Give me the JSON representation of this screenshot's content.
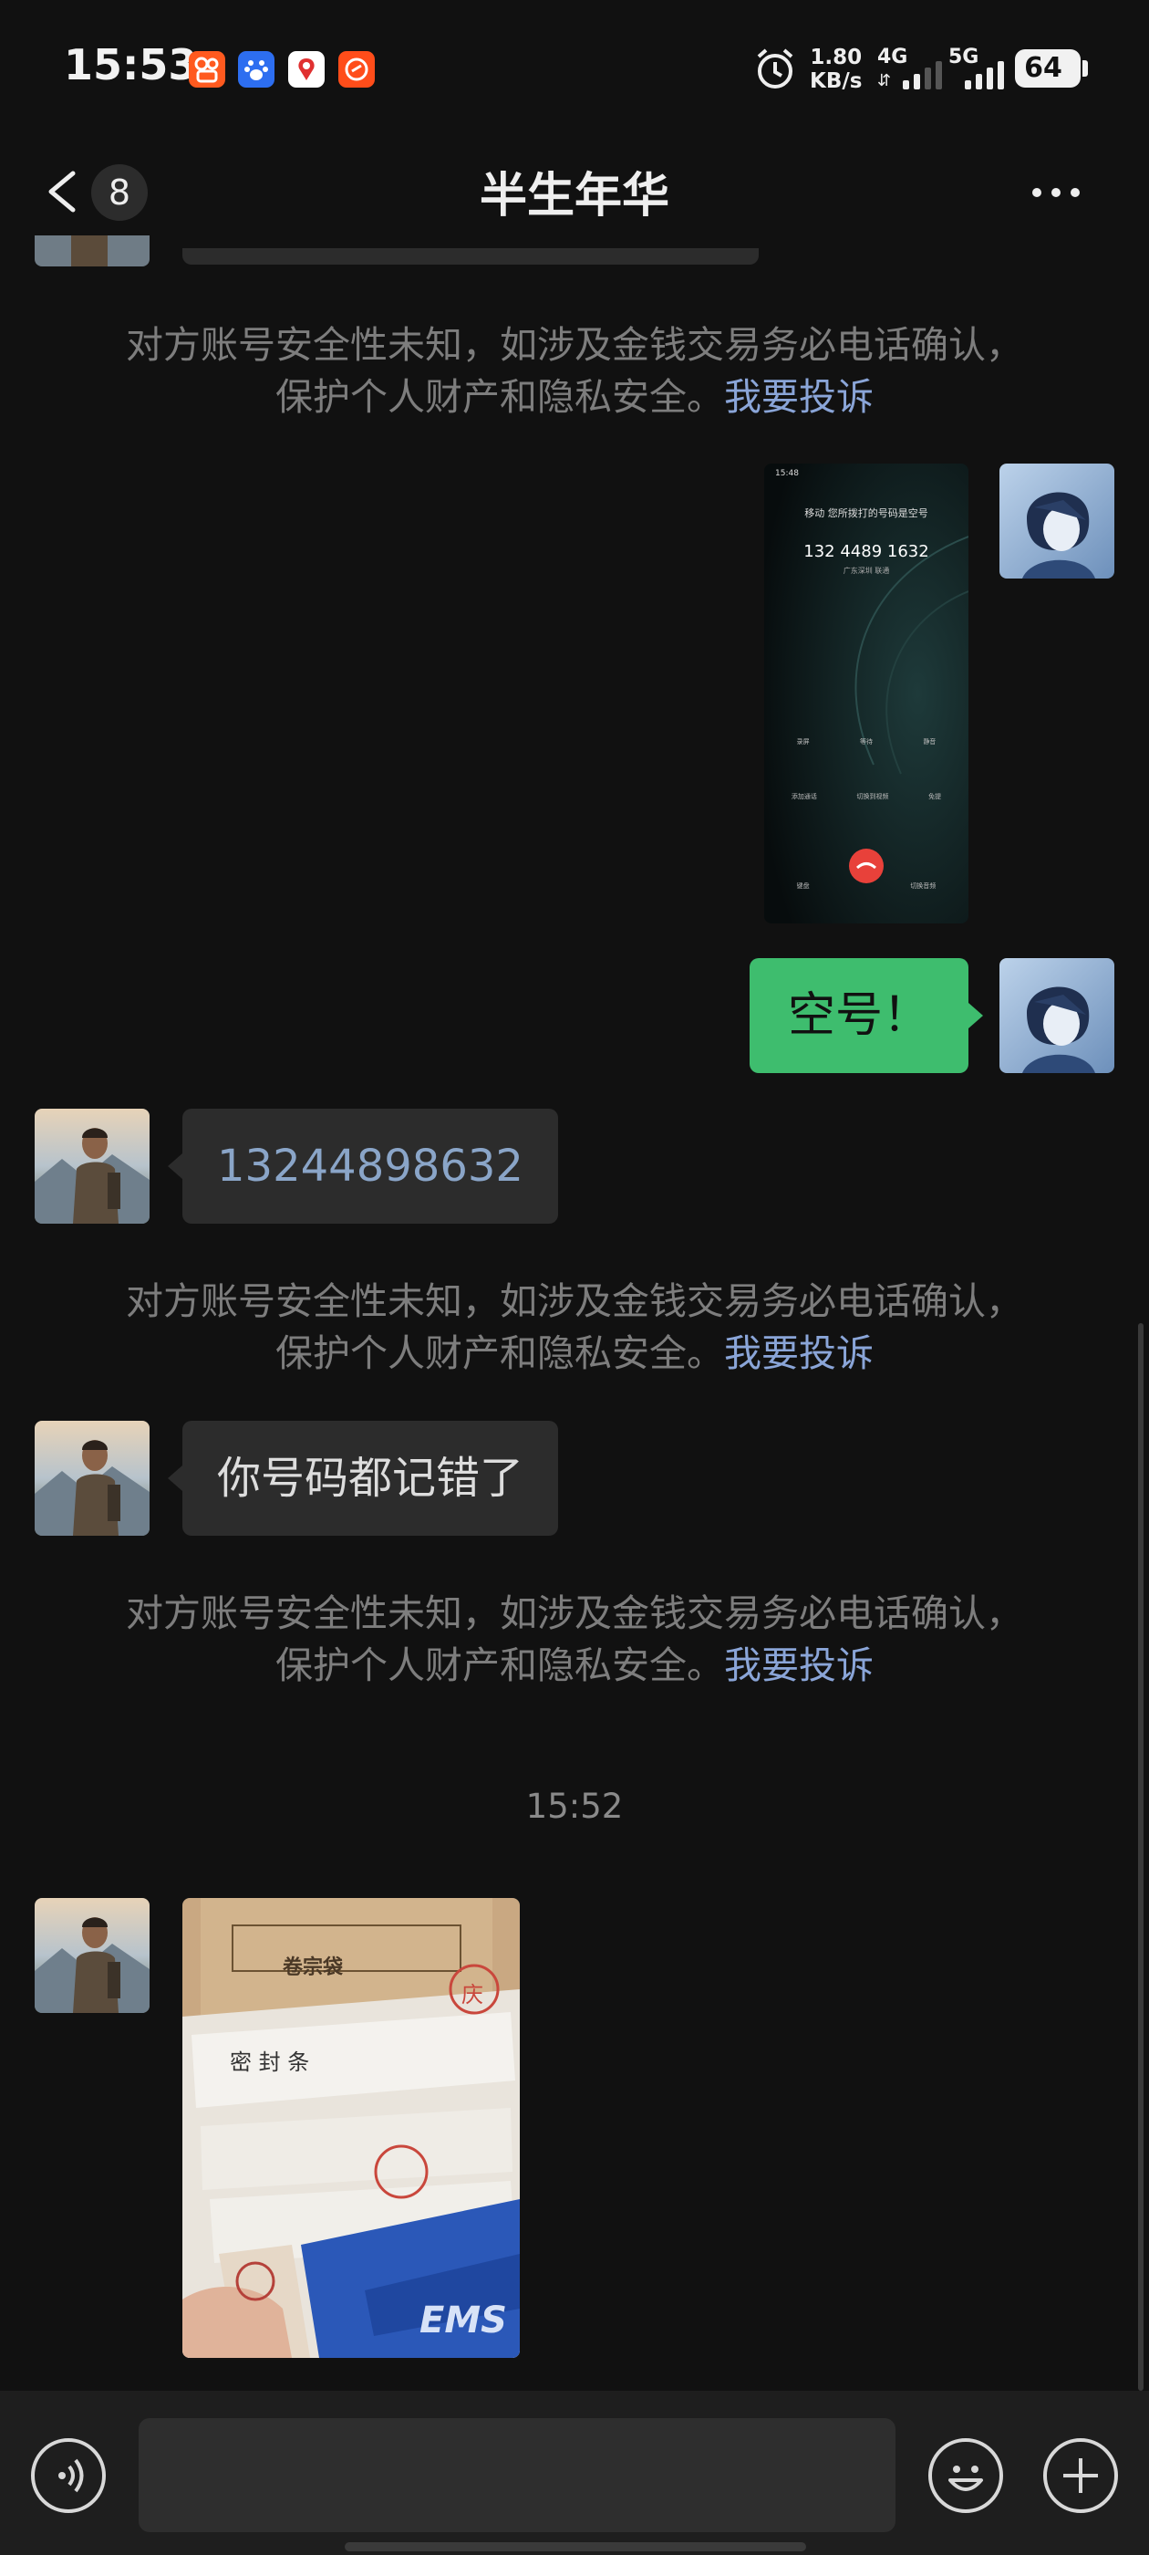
{
  "status_bar": {
    "time": "15:53",
    "net_speed_value": "1.80",
    "net_speed_unit": "KB/s",
    "sim1_label": "4G",
    "sim2_label": "5G",
    "battery": "64",
    "icons": [
      "kuaishou-app-icon",
      "baidu-app-icon",
      "maps-app-icon",
      "shop-app-icon",
      "alarm-icon"
    ]
  },
  "header": {
    "back_count": "8",
    "title": "半生年华"
  },
  "messages": {
    "warning_text": "对方账号安全性未知，如涉及金钱交易务必电话确认，",
    "warning_text_2": "保护个人财产和隐私安全。",
    "warning_link": "我要投诉",
    "sent_text": "空号！",
    "received_number": "13244898632",
    "received_text": "你号码都记错了",
    "timestamp": "15:52"
  },
  "screenshot_thumb": {
    "status_time": "15:48",
    "caller_line": "移动  您所拨打的号码是空号",
    "dialed_number": "132 4489 1632",
    "location": "广东深圳 联通",
    "buttons_row1": [
      "录屏",
      "等待",
      "静音"
    ],
    "buttons_row2": [
      "添加通话",
      "切换到视频",
      "免提"
    ],
    "buttons_row3": [
      "键盘",
      "",
      "切换音频"
    ]
  },
  "photo_thumb": {
    "top_text": "卷宗袋",
    "seal_text": "密    封    条",
    "stamp_char": "庆",
    "brand_text": "EMS"
  },
  "colors": {
    "background": "#111111",
    "bubble_received": "#2c2c2c",
    "bubble_sent": "#3ebd6e",
    "link": "#8aa5d8"
  }
}
